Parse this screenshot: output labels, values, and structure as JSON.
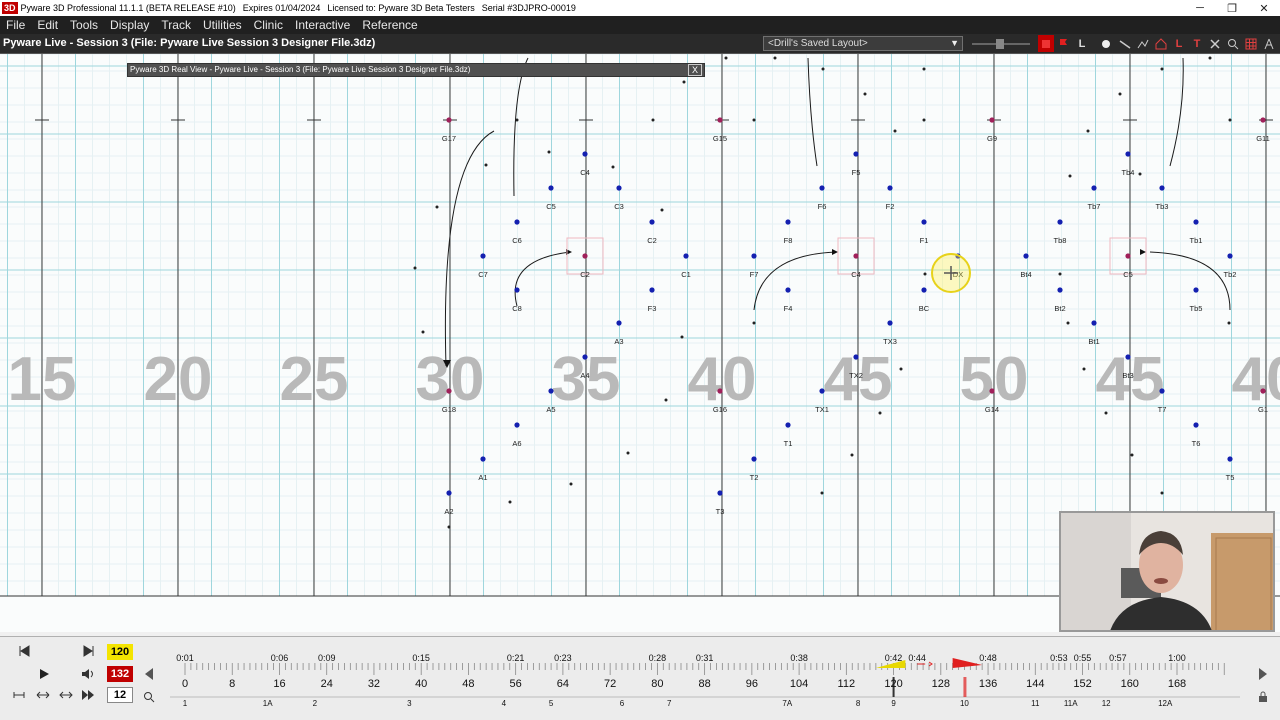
{
  "titlebar": {
    "logo": "3D",
    "app_name": "Pyware 3D Professional 11.1.1  (BETA RELEASE #10)",
    "expires": "Expires 01/04/2024",
    "license": "Licensed to: Pyware 3D Beta Testers",
    "serial": "Serial #3DJPRO-00019",
    "minimize": "─",
    "maximize": "❐",
    "close": "✕"
  },
  "menu": [
    "File",
    "Edit",
    "Tools",
    "Display",
    "Track",
    "Utilities",
    "Clinic",
    "Interactive",
    "Reference"
  ],
  "header": {
    "session_title": "Pyware Live - Session 3  (File: Pyware Live Session 3 Designer File.3dz)",
    "layout_select": "<Drill's Saved Layout>",
    "tool_labels": [
      "L",
      "L",
      "T"
    ]
  },
  "realview": {
    "title": "Pyware 3D Real View - Pyware Live - Session 3  (File: Pyware Live Session 3 Designer File.3dz)",
    "close": "X"
  },
  "field": {
    "yard_numbers": [
      "15",
      "20",
      "25",
      "30",
      "35",
      "40",
      "45",
      "50",
      "45",
      "40"
    ],
    "performers": [
      [
        "G17",
        449,
        120,
        "p"
      ],
      [
        "G15",
        720,
        120,
        "p"
      ],
      [
        "G9",
        992,
        120,
        "p"
      ],
      [
        "G11",
        1263,
        120,
        "p"
      ],
      [
        "C4",
        585,
        154,
        "b"
      ],
      [
        "F5",
        856,
        154,
        "b"
      ],
      [
        "Tb4",
        1128,
        154,
        "b"
      ],
      [
        "C5",
        551,
        188,
        "b"
      ],
      [
        "C3",
        619,
        188,
        "b"
      ],
      [
        "F6",
        822,
        188,
        "b"
      ],
      [
        "F2",
        890,
        188,
        "b"
      ],
      [
        "Tb7",
        1094,
        188,
        "b"
      ],
      [
        "Tb3",
        1162,
        188,
        "b"
      ],
      [
        "C6",
        517,
        222,
        "b"
      ],
      [
        "C2",
        652,
        222,
        "b"
      ],
      [
        "F8",
        788,
        222,
        "b"
      ],
      [
        "F1",
        924,
        222,
        "b"
      ],
      [
        "Tb8",
        1060,
        222,
        "b"
      ],
      [
        "Tb1",
        1196,
        222,
        "b"
      ],
      [
        "C7",
        483,
        256,
        "b"
      ],
      [
        "C2",
        585,
        256,
        "p"
      ],
      [
        "C1",
        686,
        256,
        "b"
      ],
      [
        "F7",
        754,
        256,
        "b"
      ],
      [
        "C4",
        856,
        256,
        "p"
      ],
      [
        "DX",
        958,
        256,
        "b"
      ],
      [
        "Bt4",
        1026,
        256,
        "b"
      ],
      [
        "C5",
        1128,
        256,
        "p"
      ],
      [
        "Tb2",
        1230,
        256,
        "b"
      ],
      [
        "C8",
        517,
        290,
        "b"
      ],
      [
        "F3",
        652,
        290,
        "b"
      ],
      [
        "F4",
        788,
        290,
        "b"
      ],
      [
        "BC",
        924,
        290,
        "b"
      ],
      [
        "Bt2",
        1060,
        290,
        "b"
      ],
      [
        "Tb5",
        1196,
        290,
        "b"
      ],
      [
        "A3",
        619,
        323,
        "b"
      ],
      [
        "TX3",
        890,
        323,
        "b"
      ],
      [
        "Bt1",
        1094,
        323,
        "b"
      ],
      [
        "A4",
        585,
        357,
        "b"
      ],
      [
        "TX2",
        856,
        357,
        "b"
      ],
      [
        "Bt3",
        1128,
        357,
        "b"
      ],
      [
        "G18",
        449,
        391,
        "p"
      ],
      [
        "A5",
        551,
        391,
        "b"
      ],
      [
        "G16",
        720,
        391,
        "p"
      ],
      [
        "TX1",
        822,
        391,
        "b"
      ],
      [
        "G14",
        992,
        391,
        "p"
      ],
      [
        "T7",
        1162,
        391,
        "b"
      ],
      [
        "G1",
        1263,
        391,
        "p"
      ],
      [
        "A6",
        517,
        425,
        "b"
      ],
      [
        "T1",
        788,
        425,
        "b"
      ],
      [
        "T6",
        1196,
        425,
        "b"
      ],
      [
        "A1",
        483,
        459,
        "b"
      ],
      [
        "T2",
        754,
        459,
        "b"
      ],
      [
        "T5",
        1230,
        459,
        "b"
      ],
      [
        "A2",
        449,
        493,
        "b"
      ],
      [
        "T3",
        720,
        493,
        "b"
      ]
    ]
  },
  "timeline": {
    "start_count": "120",
    "total_counts": "132",
    "tempo": "12",
    "times": [
      [
        "0:01",
        0
      ],
      [
        "0:06",
        16
      ],
      [
        "0:09",
        24
      ],
      [
        "0:15",
        40
      ],
      [
        "0:21",
        56
      ],
      [
        "0:23",
        64
      ],
      [
        "0:28",
        80
      ],
      [
        "0:31",
        88
      ],
      [
        "0:38",
        104
      ],
      [
        "0:42",
        120
      ],
      [
        "0:44",
        124
      ],
      [
        "0:48",
        136
      ],
      [
        "0:53",
        148
      ],
      [
        "0:55",
        152
      ],
      [
        "0:57",
        158
      ],
      [
        "1:00",
        168
      ]
    ],
    "counts": [
      "0",
      "8",
      "16",
      "24",
      "32",
      "40",
      "48",
      "56",
      "64",
      "72",
      "80",
      "88",
      "96",
      "104",
      "112",
      "120",
      "128",
      "136",
      "144",
      "152",
      "160",
      "168"
    ],
    "sets": [
      [
        "1",
        0
      ],
      [
        "1A",
        14
      ],
      [
        "2",
        22
      ],
      [
        "3",
        38
      ],
      [
        "4",
        54
      ],
      [
        "5",
        62
      ],
      [
        "6",
        74
      ],
      [
        "7",
        82
      ],
      [
        "7A",
        102
      ],
      [
        "8",
        114
      ],
      [
        "9",
        120
      ],
      [
        "10",
        132
      ],
      [
        "11",
        144
      ],
      [
        "11A",
        150
      ],
      [
        "12",
        156
      ],
      [
        "12A",
        166
      ]
    ]
  }
}
